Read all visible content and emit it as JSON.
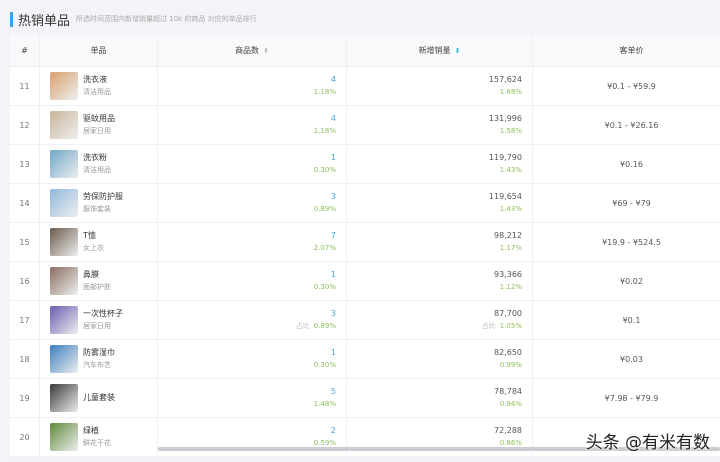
{
  "header": {
    "title": "热销单品",
    "subtitle": "所选时间范围内新增销量超过 10k 的商品 对应的单品排行"
  },
  "columns": [
    "#",
    "单品",
    "商品数",
    "新增销量",
    "客单价"
  ],
  "share_label": "占比",
  "rows": [
    {
      "rank": "11",
      "name": "洗衣液",
      "category": "清洁用品",
      "count": "4",
      "count_pct": "1.18%",
      "sales": "157,624",
      "sales_pct": "1.88%",
      "price": "¥0.1 - ¥59.9",
      "thumb": "#d9a070"
    },
    {
      "rank": "12",
      "name": "驱蚊用品",
      "category": "居家日用",
      "count": "4",
      "count_pct": "1.18%",
      "sales": "131,996",
      "sales_pct": "1.58%",
      "price": "¥0.1 - ¥26.16",
      "thumb": "#c9b59a"
    },
    {
      "rank": "13",
      "name": "洗衣粉",
      "category": "清洁用品",
      "count": "1",
      "count_pct": "0.30%",
      "sales": "119,790",
      "sales_pct": "1.43%",
      "price": "¥0.16",
      "thumb": "#6fa8c8"
    },
    {
      "rank": "14",
      "name": "劳保防护服",
      "category": "服饰套装",
      "count": "3",
      "count_pct": "0.89%",
      "sales": "119,654",
      "sales_pct": "1.43%",
      "price": "¥69 - ¥79",
      "thumb": "#8fb8dc"
    },
    {
      "rank": "15",
      "name": "T恤",
      "category": "女上衣",
      "count": "7",
      "count_pct": "2.07%",
      "sales": "98,212",
      "sales_pct": "1.17%",
      "price": "¥19.9 - ¥524.5",
      "thumb": "#6b5a4c"
    },
    {
      "rank": "16",
      "name": "鼻膜",
      "category": "面部护肤",
      "count": "1",
      "count_pct": "0.30%",
      "sales": "93,366",
      "sales_pct": "1.12%",
      "price": "¥0.02",
      "thumb": "#8a6e60"
    },
    {
      "rank": "17",
      "name": "一次性杯子",
      "category": "居家日用",
      "count": "3",
      "count_pct": "0.89%",
      "sales": "87,700",
      "sales_pct": "1.05%",
      "price": "¥0.1",
      "thumb": "#6a5cb0",
      "show_share_label": true
    },
    {
      "rank": "18",
      "name": "防雾湿巾",
      "category": "汽车布艺",
      "count": "1",
      "count_pct": "0.30%",
      "sales": "82,650",
      "sales_pct": "0.99%",
      "price": "¥0.03",
      "thumb": "#3c7fc0"
    },
    {
      "rank": "19",
      "name": "儿童套装",
      "category": "",
      "count": "5",
      "count_pct": "1.48%",
      "sales": "78,784",
      "sales_pct": "0.94%",
      "price": "¥7.98 - ¥79.9",
      "thumb": "#3a3a3a"
    },
    {
      "rank": "20",
      "name": "绿植",
      "category": "鲜花干花",
      "count": "2",
      "count_pct": "0.59%",
      "sales": "72,288",
      "sales_pct": "0.86%",
      "price": "",
      "thumb": "#5f8a3a"
    }
  ],
  "watermark": "头条 @有米有数",
  "colors": {
    "accent": "#3aa0e8",
    "count": "#42a5e0",
    "percent": "#8cbf5a"
  }
}
